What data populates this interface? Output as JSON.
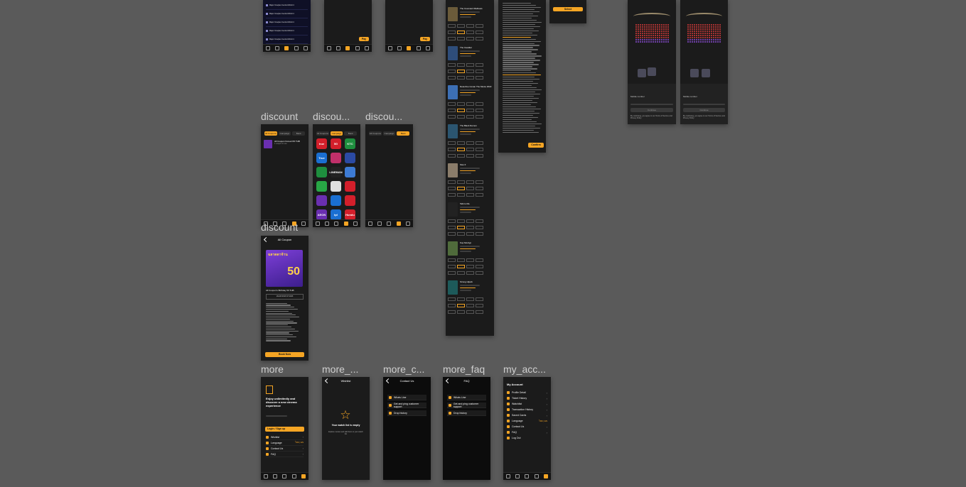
{
  "labels": {
    "discount_1": "discount",
    "discount_2": "discou...",
    "discount_3": "discou...",
    "discount_4": "discount",
    "more": "more",
    "more_wishlist": "more_...",
    "more_contact": "more_c...",
    "more_faq": "more_faq",
    "my_account": "my_acc..."
  },
  "top_screens": {
    "list_item_text": "Major Cineplex Central World 4",
    "pay_button": "Pay",
    "select_button": "Select"
  },
  "discount_tabs": [
    "All Coupons",
    "Campaign",
    "Bank"
  ],
  "coupon_item": {
    "title": "All Coupon Korea FW THB",
    "subtitle": "1 coupon in use"
  },
  "partner_logos": [
    "true",
    "5G",
    "KTC",
    "True",
    "",
    "",
    "",
    "LINEMAN",
    "",
    "",
    "",
    "",
    "",
    "",
    "",
    "AEON",
    "tpl",
    "Hundu"
  ],
  "coupon_detail": {
    "header": "All Coupon",
    "banner_big": "50",
    "banner_title": "ฉลาดดาจ้าน",
    "name": "All Coupon's Birthday 50 THB",
    "code": "VALID NOW AT 2023",
    "book_now": "Book Now"
  },
  "movies": [
    {
      "title": "The Covenant Mathews",
      "color": "#6b5b3a"
    },
    {
      "title": "The Cavalier",
      "color": "#2e4d7a"
    },
    {
      "title": "Detective Conan The Movie 2022",
      "color": "#3c6fb5"
    },
    {
      "title": "The Black Demon",
      "color": "#2b5570"
    },
    {
      "title": "Sisu II",
      "color": "#8a7c6a"
    },
    {
      "title": "Talk to Me",
      "color": "#222222"
    },
    {
      "title": "Kop Mordyp",
      "color": "#4f6b3b"
    },
    {
      "title": "Strong Hijack",
      "color": "#1d5a5a"
    }
  ],
  "terms": {
    "heading": "FAQ",
    "button": "Confirm"
  },
  "seat_panel": {
    "mobile_number_label": "Mobile number",
    "continue": "Continue",
    "note": "By continuing, you agree to our Terms of Service and Privacy Policy"
  },
  "more_screen": {
    "headline": "Enjoy unlimitedly and discover a new cinema experience",
    "login_button": "Login / Sign up",
    "items": [
      "Wishlist",
      "Language",
      "Contact Us",
      "FAQ"
    ],
    "language_value": "ไทย | EN"
  },
  "wishlist_screen": {
    "header": "Wishlist",
    "empty_title": "Your watch list is empty",
    "empty_text": "Explore movies and add them to your watch list"
  },
  "contact_screen": {
    "header": "Contact Us",
    "items": [
      "Whats Line",
      "Get and ping customer support",
      "Drop history"
    ]
  },
  "faq_screen": {
    "header": "FAQ",
    "items": [
      "Whats Line",
      "Get and ping customer support",
      "Drop history"
    ]
  },
  "account_screen": {
    "header": "My Account",
    "items": [
      "Profile Detail",
      "Ticket History",
      "Watchlist",
      "Transaction History",
      "Saved Cards",
      "Language",
      "Contact Us",
      "FAQ",
      "Log Out"
    ],
    "language_value": "ไทย | EN"
  },
  "colors": {
    "accent": "#f5a524",
    "canvas": "#5a5a5a",
    "frame": "#1b1b1b"
  }
}
